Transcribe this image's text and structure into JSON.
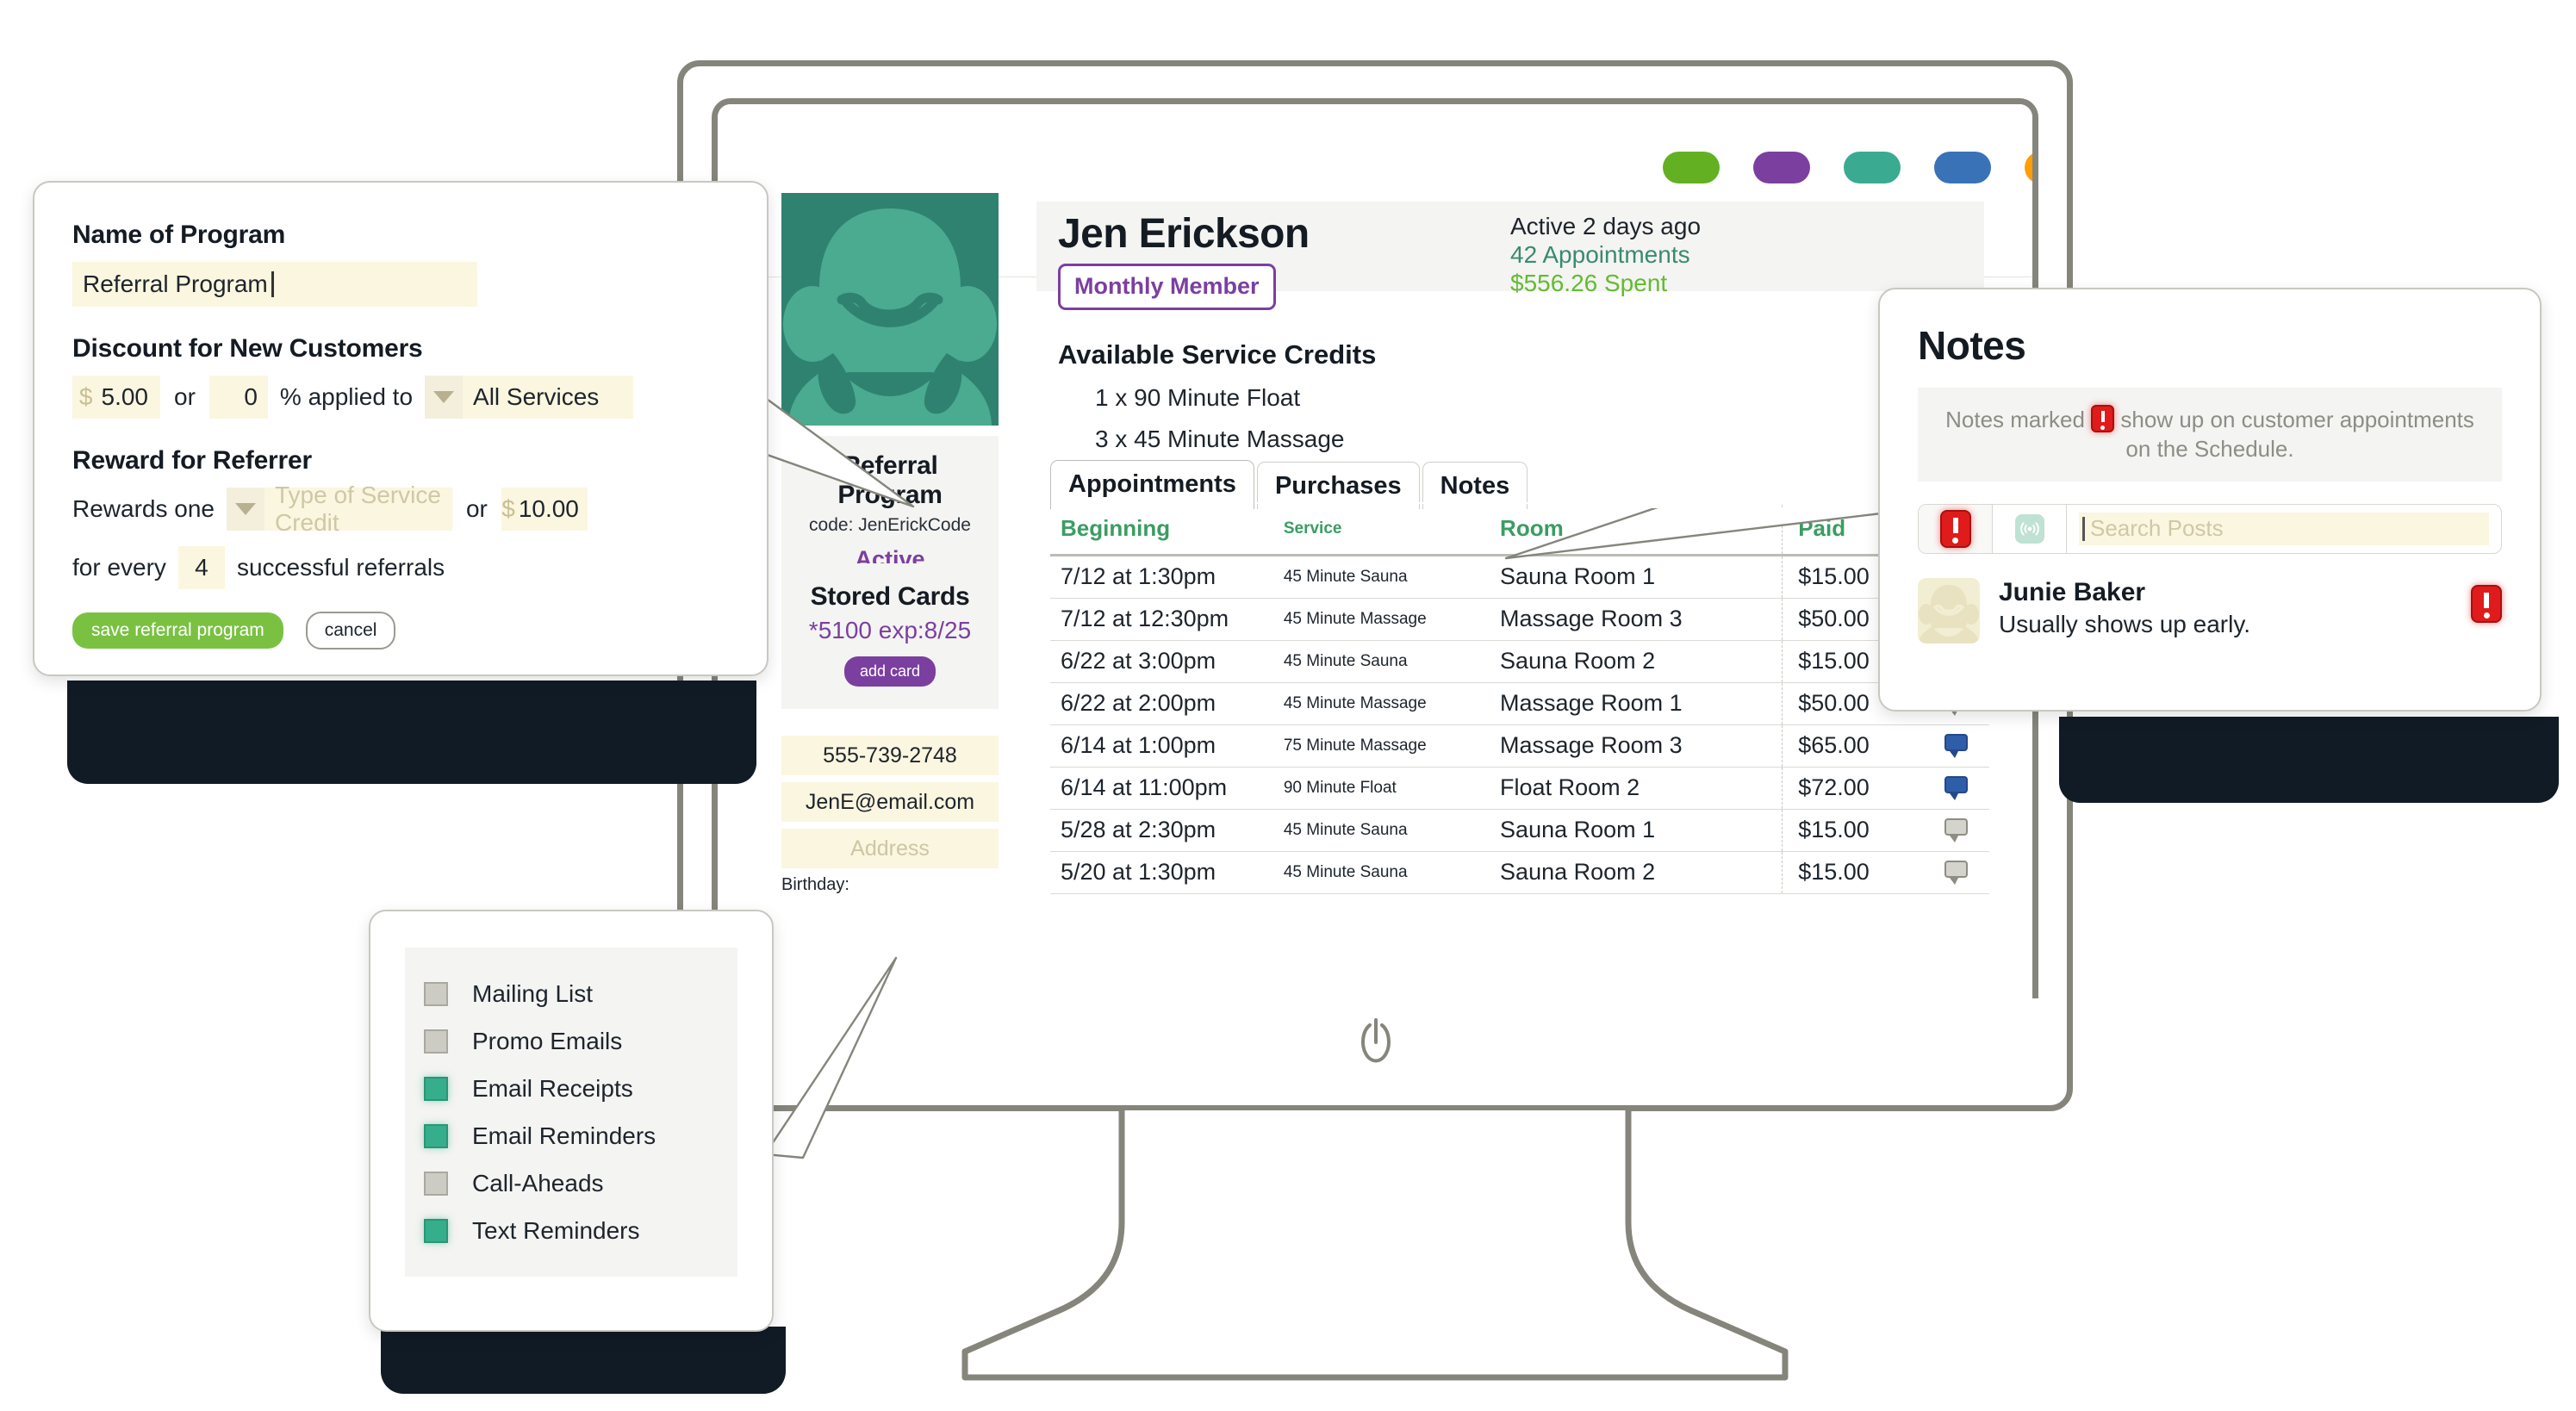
{
  "monitor": {
    "nav_pills": [
      {
        "name": "pill-green",
        "color": "#64b023"
      },
      {
        "name": "pill-purple",
        "color": "#7b3fa0"
      },
      {
        "name": "pill-teal",
        "color": "#3aab91"
      },
      {
        "name": "pill-blue",
        "color": "#3a72b8"
      },
      {
        "name": "pill-orange",
        "color": "#ff9e00"
      },
      {
        "name": "pill-pink",
        "color": "#d8176e"
      }
    ],
    "power_icon": "power-icon"
  },
  "profile": {
    "avatar_icon": "customer-avatar",
    "name": "Jen Erickson",
    "membership_badge": "Monthly Member",
    "last_active": "Active 2 days ago",
    "appointments_count": "42 Appointments",
    "amount_spent": "$556.26 Spent",
    "credits_title": "Available Service Credits",
    "credits": [
      "1 x 90 Minute Float",
      "3 x 45 Minute Massage"
    ],
    "referral_card": {
      "title": "Referral Program",
      "code": "code: JenErickCode",
      "status": "Active"
    },
    "stored_cards": {
      "title": "Stored Cards",
      "card": "*5100 exp:8/25",
      "add_button": "add card"
    },
    "phone": "555-739-2748",
    "email": "JenE@email.com",
    "address_placeholder": "Address",
    "birthday_label": "Birthday:"
  },
  "tabs": [
    {
      "label": "Appointments",
      "active": true
    },
    {
      "label": "Purchases",
      "active": false
    },
    {
      "label": "Notes",
      "active": false
    }
  ],
  "appointments_table": {
    "columns": [
      "Beginning",
      "Service",
      "Room",
      "Paid"
    ],
    "rows": [
      {
        "beginning": "7/12 at 1:30pm",
        "service": "45 Minute Sauna",
        "room": "Sauna Room 1",
        "paid": "$15.00",
        "note": "grey"
      },
      {
        "beginning": "7/12 at 12:30pm",
        "service": "45 Minute Massage",
        "room": "Massage Room 3",
        "paid": "$50.00",
        "note": "grey"
      },
      {
        "beginning": "6/22 at 3:00pm",
        "service": "45 Minute Sauna",
        "room": "Sauna Room 2",
        "paid": "$15.00",
        "note": "grey"
      },
      {
        "beginning": "6/22 at 2:00pm",
        "service": "45 Minute Massage",
        "room": "Massage Room 1",
        "paid": "$50.00",
        "note": "grey"
      },
      {
        "beginning": "6/14 at 1:00pm",
        "service": "75 Minute Massage",
        "room": "Massage Room 3",
        "paid": "$65.00",
        "note": "blue"
      },
      {
        "beginning": "6/14 at 11:00pm",
        "service": "90 Minute Float",
        "room": "Float Room 2",
        "paid": "$72.00",
        "note": "blue"
      },
      {
        "beginning": "5/28 at 2:30pm",
        "service": "45 Minute Sauna",
        "room": "Sauna Room 1",
        "paid": "$15.00",
        "note": "grey"
      },
      {
        "beginning": "5/20 at 1:30pm",
        "service": "45 Minute Sauna",
        "room": "Sauna Room 2",
        "paid": "$15.00",
        "note": "grey"
      }
    ]
  },
  "referral_form": {
    "name_label": "Name of Program",
    "name_value": "Referral Program",
    "discount_label": "Discount for New Customers",
    "discount_currency": "$",
    "discount_amount": "5.00",
    "discount_or": "or",
    "discount_percent": "0",
    "discount_applied_to": "% applied to",
    "discount_scope": "All Services",
    "reward_label": "Reward for Referrer",
    "reward_prefix": "Rewards one",
    "reward_credit_placeholder": "Type of Service Credit",
    "reward_or": "or",
    "reward_currency": "$",
    "reward_amount": "10.00",
    "every_prefix": "for every",
    "every_count": "4",
    "every_suffix": "successful referrals",
    "save_label": "save referral program",
    "cancel_label": "cancel"
  },
  "notes_panel": {
    "title": "Notes",
    "hint_before": "Notes marked",
    "hint_after": "show up on customer appointments on the Schedule.",
    "flag_icon": "alert-flag-icon",
    "broadcast_icon": "broadcast-icon",
    "search_placeholder": "Search Posts",
    "note": {
      "author": "Junie Baker",
      "text": "Usually shows up early.",
      "avatar_icon": "note-author-avatar",
      "flagged_icon": "alert-flag-icon"
    }
  },
  "preferences": {
    "items": [
      {
        "label": "Mailing List",
        "checked": false
      },
      {
        "label": "Promo Emails",
        "checked": false
      },
      {
        "label": "Email Receipts",
        "checked": true
      },
      {
        "label": "Email Reminders",
        "checked": true
      },
      {
        "label": "Call-Aheads",
        "checked": false
      },
      {
        "label": "Text Reminders",
        "checked": true
      }
    ]
  }
}
